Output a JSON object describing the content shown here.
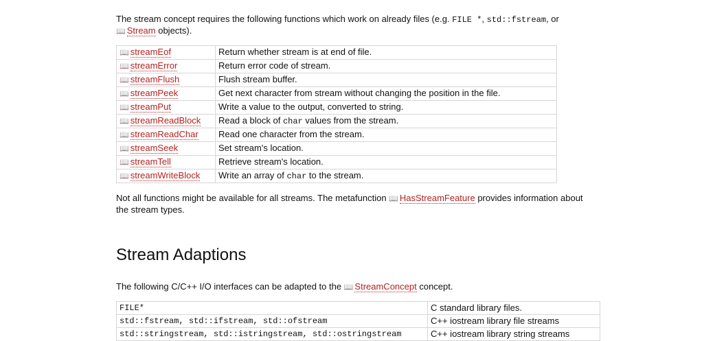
{
  "intro": {
    "pre": "The stream concept requires the following functions which work on already files (e.g. ",
    "code1": "FILE *",
    "sep": ", ",
    "code2": "std::fstream",
    "or": ", or ",
    "link": "Stream",
    "post": " objects)."
  },
  "functions": [
    {
      "name": "streamEof",
      "desc_pre": "Return whether stream is at end of file.",
      "code": "",
      "desc_post": ""
    },
    {
      "name": "streamError",
      "desc_pre": "Return error code of stream.",
      "code": "",
      "desc_post": ""
    },
    {
      "name": "streamFlush",
      "desc_pre": "Flush stream buffer.",
      "code": "",
      "desc_post": ""
    },
    {
      "name": "streamPeek",
      "desc_pre": "Get next character from stream without changing the position in the file.",
      "code": "",
      "desc_post": ""
    },
    {
      "name": "streamPut",
      "desc_pre": "Write a value to the output, converted to string.",
      "code": "",
      "desc_post": ""
    },
    {
      "name": "streamReadBlock",
      "desc_pre": "Read a block of ",
      "code": "char",
      "desc_post": " values from the stream."
    },
    {
      "name": "streamReadChar",
      "desc_pre": "Read one character from the stream.",
      "code": "",
      "desc_post": ""
    },
    {
      "name": "streamSeek",
      "desc_pre": "Set stream's location.",
      "code": "",
      "desc_post": ""
    },
    {
      "name": "streamTell",
      "desc_pre": "Retrieve stream's location.",
      "code": "",
      "desc_post": ""
    },
    {
      "name": "streamWriteBlock",
      "desc_pre": "Write an array of ",
      "code": "char",
      "desc_post": " to the stream."
    }
  ],
  "note": {
    "pre": "Not all functions might be available for all streams. The metafunction ",
    "link": "HasStreamFeature",
    "post": " provides information about the stream types."
  },
  "section_title": "Stream Adaptions",
  "adapt_intro": {
    "pre": "The following C/C++ I/O interfaces can be adapted to the ",
    "link": "StreamConcept",
    "post": " concept."
  },
  "adaptions": [
    {
      "iface": "FILE*",
      "desc": "C standard library files."
    },
    {
      "iface": "std::fstream, std::ifstream, std::ofstream",
      "desc": "C++ iostream library file streams"
    },
    {
      "iface": "std::stringstream, std::istringstream, std::ostringstream",
      "desc": "C++ iostream library string streams"
    }
  ],
  "icons": {
    "link_icon": "book-icon"
  },
  "colors": {
    "link": "#b22222",
    "border": "#d6d6d6"
  }
}
